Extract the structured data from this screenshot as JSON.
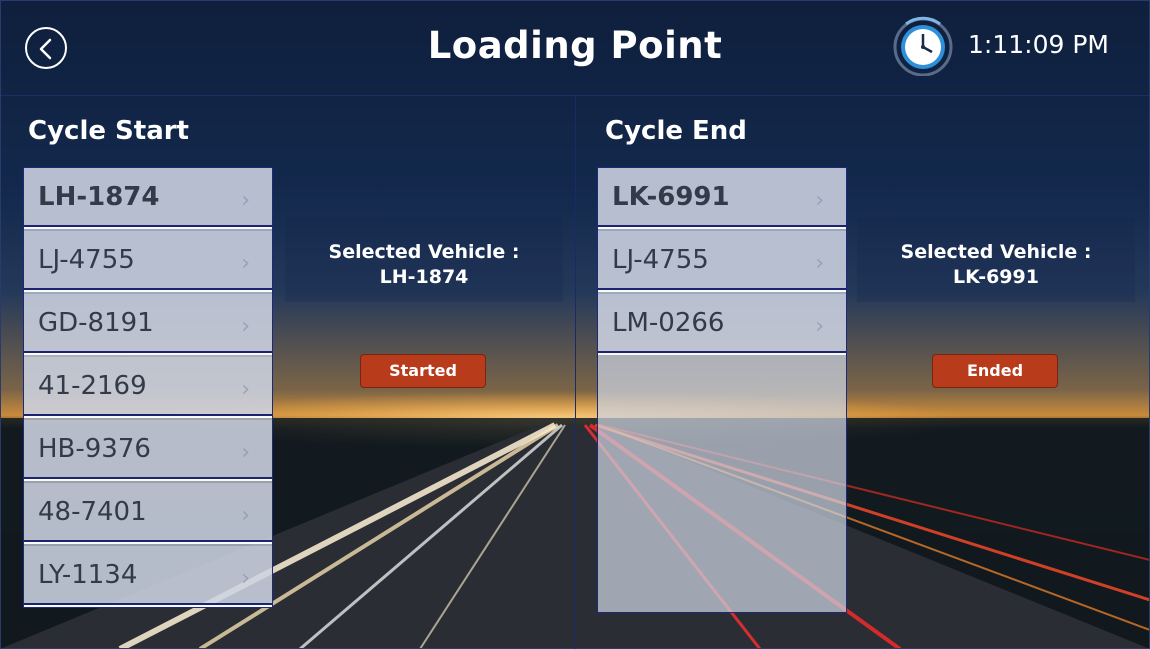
{
  "header": {
    "title": "Loading Point",
    "time": "1:11:09 PM",
    "back_icon": "back-arrow-icon",
    "clock_icon": "clock-icon"
  },
  "cycle_start": {
    "title": "Cycle Start",
    "vehicles": [
      "LH-1874",
      "LJ-4755",
      "GD-8191",
      "41-2169",
      "HB-9376",
      "48-7401",
      "LY-1134"
    ],
    "selected_label": "Selected Vehicle :",
    "selected_value": "LH-1874",
    "status_button": "Started"
  },
  "cycle_end": {
    "title": "Cycle End",
    "vehicles": [
      "LK-6991",
      "LJ-4755",
      "LM-0266"
    ],
    "selected_label": "Selected Vehicle :",
    "selected_value": "LK-6991",
    "status_button": "Ended"
  },
  "colors": {
    "button": "#b83b1b",
    "list_border": "#1b2a7a",
    "text_white": "#ffffff"
  }
}
